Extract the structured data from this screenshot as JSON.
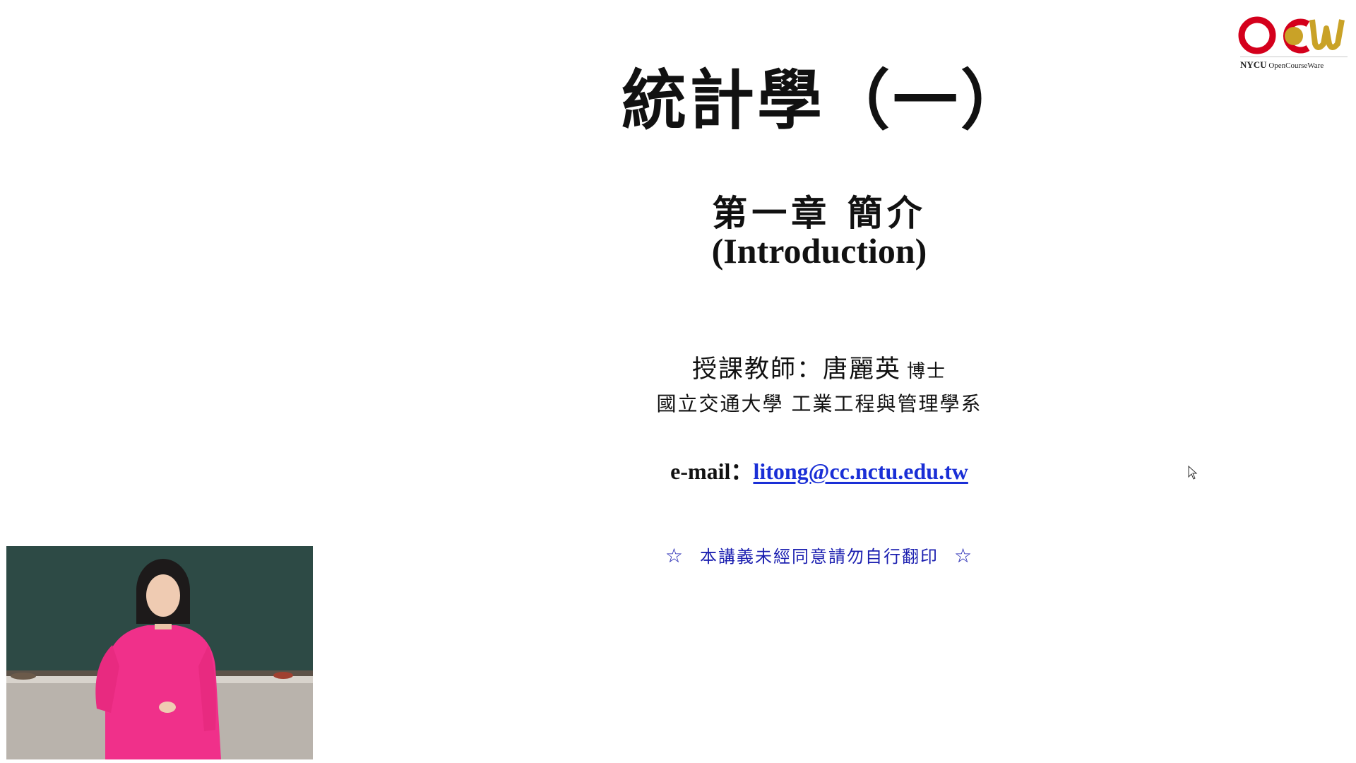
{
  "slide": {
    "title": "統計學（一）",
    "chapter": "第一章 簡介",
    "chapter_en": "(Introduction)",
    "instructor_label": "授課教師：唐麗英",
    "instructor_honorific": "博士",
    "department": "國立交通大學 工業工程與管理學系",
    "email_label": "e-mail：",
    "email_link": "litong@cc.nctu.edu.tw",
    "notice_star": "☆",
    "notice_text": "本講義未經同意請勿自行翻印"
  },
  "logo": {
    "org": "NYCU",
    "caption": "OpenCourseWare",
    "icon": "ocw-logo-icon",
    "colors": {
      "red": "#d4001c",
      "gold": "#c9a227"
    }
  },
  "webcam": {
    "icon": "presenter-video-feed"
  },
  "colors": {
    "link": "#1a2fd6",
    "notice": "#1b1fb0",
    "text": "#111111",
    "board": "#2d4a45",
    "shirt": "#f0308a"
  }
}
